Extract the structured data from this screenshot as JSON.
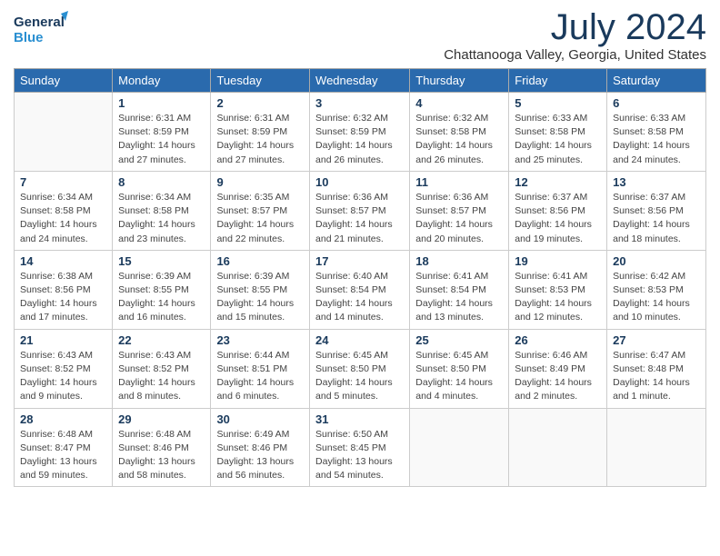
{
  "brand": {
    "name_line1": "General",
    "name_line2": "Blue"
  },
  "title": "July 2024",
  "location": "Chattanooga Valley, Georgia, United States",
  "weekdays": [
    "Sunday",
    "Monday",
    "Tuesday",
    "Wednesday",
    "Thursday",
    "Friday",
    "Saturday"
  ],
  "weeks": [
    [
      {
        "day": "",
        "info": ""
      },
      {
        "day": "1",
        "info": "Sunrise: 6:31 AM\nSunset: 8:59 PM\nDaylight: 14 hours\nand 27 minutes."
      },
      {
        "day": "2",
        "info": "Sunrise: 6:31 AM\nSunset: 8:59 PM\nDaylight: 14 hours\nand 27 minutes."
      },
      {
        "day": "3",
        "info": "Sunrise: 6:32 AM\nSunset: 8:59 PM\nDaylight: 14 hours\nand 26 minutes."
      },
      {
        "day": "4",
        "info": "Sunrise: 6:32 AM\nSunset: 8:58 PM\nDaylight: 14 hours\nand 26 minutes."
      },
      {
        "day": "5",
        "info": "Sunrise: 6:33 AM\nSunset: 8:58 PM\nDaylight: 14 hours\nand 25 minutes."
      },
      {
        "day": "6",
        "info": "Sunrise: 6:33 AM\nSunset: 8:58 PM\nDaylight: 14 hours\nand 24 minutes."
      }
    ],
    [
      {
        "day": "7",
        "info": "Sunrise: 6:34 AM\nSunset: 8:58 PM\nDaylight: 14 hours\nand 24 minutes."
      },
      {
        "day": "8",
        "info": "Sunrise: 6:34 AM\nSunset: 8:58 PM\nDaylight: 14 hours\nand 23 minutes."
      },
      {
        "day": "9",
        "info": "Sunrise: 6:35 AM\nSunset: 8:57 PM\nDaylight: 14 hours\nand 22 minutes."
      },
      {
        "day": "10",
        "info": "Sunrise: 6:36 AM\nSunset: 8:57 PM\nDaylight: 14 hours\nand 21 minutes."
      },
      {
        "day": "11",
        "info": "Sunrise: 6:36 AM\nSunset: 8:57 PM\nDaylight: 14 hours\nand 20 minutes."
      },
      {
        "day": "12",
        "info": "Sunrise: 6:37 AM\nSunset: 8:56 PM\nDaylight: 14 hours\nand 19 minutes."
      },
      {
        "day": "13",
        "info": "Sunrise: 6:37 AM\nSunset: 8:56 PM\nDaylight: 14 hours\nand 18 minutes."
      }
    ],
    [
      {
        "day": "14",
        "info": "Sunrise: 6:38 AM\nSunset: 8:56 PM\nDaylight: 14 hours\nand 17 minutes."
      },
      {
        "day": "15",
        "info": "Sunrise: 6:39 AM\nSunset: 8:55 PM\nDaylight: 14 hours\nand 16 minutes."
      },
      {
        "day": "16",
        "info": "Sunrise: 6:39 AM\nSunset: 8:55 PM\nDaylight: 14 hours\nand 15 minutes."
      },
      {
        "day": "17",
        "info": "Sunrise: 6:40 AM\nSunset: 8:54 PM\nDaylight: 14 hours\nand 14 minutes."
      },
      {
        "day": "18",
        "info": "Sunrise: 6:41 AM\nSunset: 8:54 PM\nDaylight: 14 hours\nand 13 minutes."
      },
      {
        "day": "19",
        "info": "Sunrise: 6:41 AM\nSunset: 8:53 PM\nDaylight: 14 hours\nand 12 minutes."
      },
      {
        "day": "20",
        "info": "Sunrise: 6:42 AM\nSunset: 8:53 PM\nDaylight: 14 hours\nand 10 minutes."
      }
    ],
    [
      {
        "day": "21",
        "info": "Sunrise: 6:43 AM\nSunset: 8:52 PM\nDaylight: 14 hours\nand 9 minutes."
      },
      {
        "day": "22",
        "info": "Sunrise: 6:43 AM\nSunset: 8:52 PM\nDaylight: 14 hours\nand 8 minutes."
      },
      {
        "day": "23",
        "info": "Sunrise: 6:44 AM\nSunset: 8:51 PM\nDaylight: 14 hours\nand 6 minutes."
      },
      {
        "day": "24",
        "info": "Sunrise: 6:45 AM\nSunset: 8:50 PM\nDaylight: 14 hours\nand 5 minutes."
      },
      {
        "day": "25",
        "info": "Sunrise: 6:45 AM\nSunset: 8:50 PM\nDaylight: 14 hours\nand 4 minutes."
      },
      {
        "day": "26",
        "info": "Sunrise: 6:46 AM\nSunset: 8:49 PM\nDaylight: 14 hours\nand 2 minutes."
      },
      {
        "day": "27",
        "info": "Sunrise: 6:47 AM\nSunset: 8:48 PM\nDaylight: 14 hours\nand 1 minute."
      }
    ],
    [
      {
        "day": "28",
        "info": "Sunrise: 6:48 AM\nSunset: 8:47 PM\nDaylight: 13 hours\nand 59 minutes."
      },
      {
        "day": "29",
        "info": "Sunrise: 6:48 AM\nSunset: 8:46 PM\nDaylight: 13 hours\nand 58 minutes."
      },
      {
        "day": "30",
        "info": "Sunrise: 6:49 AM\nSunset: 8:46 PM\nDaylight: 13 hours\nand 56 minutes."
      },
      {
        "day": "31",
        "info": "Sunrise: 6:50 AM\nSunset: 8:45 PM\nDaylight: 13 hours\nand 54 minutes."
      },
      {
        "day": "",
        "info": ""
      },
      {
        "day": "",
        "info": ""
      },
      {
        "day": "",
        "info": ""
      }
    ]
  ]
}
